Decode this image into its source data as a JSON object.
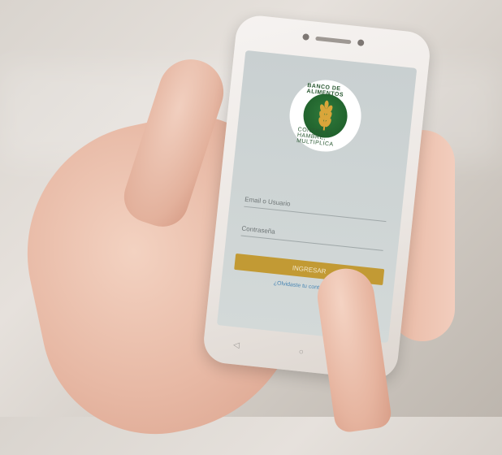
{
  "status_bar": {
    "left": "",
    "right": ""
  },
  "logo": {
    "top_text": "BANCO DE ALIMENTOS",
    "bottom_text": "CONTRA EL HAMBRE, MULTIPLICA",
    "icon": "wheat-icon"
  },
  "form": {
    "email_placeholder": "Email o Usuario",
    "password_placeholder": "Contraseña",
    "login_label": "INGRESAR",
    "forgot_label": "¿Olvidaste tu contraseña?"
  },
  "colors": {
    "brand_green": "#1f5f2b",
    "button_gold": "#c29a34",
    "link_blue": "#4b87b4"
  }
}
